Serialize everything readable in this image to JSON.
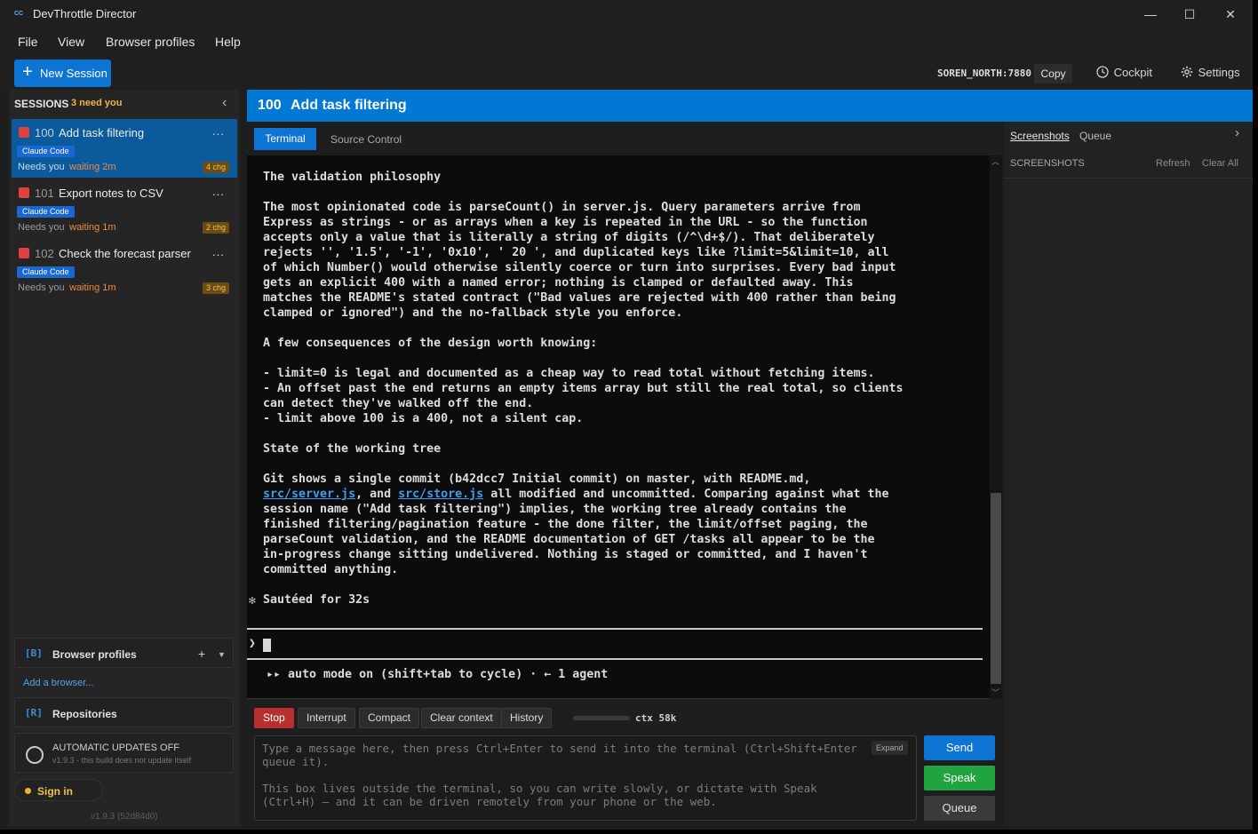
{
  "app": {
    "logo_text": "CC",
    "title": "DevThrottle Director"
  },
  "window": {
    "minimize": "—",
    "maximize": "☐",
    "close": "✕"
  },
  "menu": [
    "File",
    "View",
    "Browser profiles",
    "Help"
  ],
  "toolbar": {
    "new_session_icon": "+",
    "new_session_label": "New Session",
    "host": "SOREN_NORTH:7880",
    "copy_label": "Copy",
    "cockpit_icon": "clock-icon",
    "cockpit_label": "Cockpit",
    "settings_icon": "gear-icon",
    "settings_label": "Settings"
  },
  "sidebar": {
    "heading": "SESSIONS",
    "need_count": "3 need you",
    "collapse_glyph": "‹",
    "sessions": [
      {
        "num": "100",
        "title": "Add task filtering",
        "menu": "...",
        "badge": "Claude Code",
        "needs": "Needs you",
        "waiting": "waiting 2m",
        "changes": "4 chg"
      },
      {
        "num": "101",
        "title": "Export notes to CSV",
        "menu": "...",
        "badge": "Claude Code",
        "needs": "Needs you",
        "waiting": "waiting 1m",
        "changes": "2 chg"
      },
      {
        "num": "102",
        "title": "Check the forecast parser",
        "menu": "...",
        "badge": "Claude Code",
        "needs": "Needs you",
        "waiting": "waiting 1m",
        "changes": "3 chg"
      }
    ],
    "browser_profiles": {
      "tag": "[B]",
      "label": "Browser profiles",
      "plus": "+",
      "chevron": "▼",
      "add_link": "Add a browser..."
    },
    "repositories": {
      "tag": "[R]",
      "label": "Repositories"
    },
    "updates": {
      "title": "AUTOMATIC UPDATES OFF",
      "subtitle": "v1.9.3 - this build does not update itself"
    },
    "signin_label": "Sign in",
    "version": "v1.9.3 (52d84d0)"
  },
  "header": {
    "num": "100",
    "title": "Add task filtering"
  },
  "tabs": {
    "terminal": "Terminal",
    "source_control": "Source Control"
  },
  "terminal": {
    "l01": "The validation philosophy",
    "l02": "The most opinionated code is parseCount() in server.js. Query parameters arrive from",
    "l03": "Express as strings - or as arrays when a key is repeated in the URL - so the function",
    "l04": "accepts only a value that is literally a string of digits (/^\\d+$/). That deliberately",
    "l05": "rejects '', '1.5', '-1', '0x10', ' 20 ', and duplicated keys like ?limit=5&limit=10, all",
    "l06": "of which Number() would otherwise silently coerce or turn into surprises. Every bad input",
    "l07": "gets an explicit 400 with a named error; nothing is clamped or defaulted away. This",
    "l08": "matches the README's stated contract (\"Bad values are rejected with 400 rather than being",
    "l09": "clamped or ignored\") and the no-fallback style you enforce.",
    "l10": "A few consequences of the design worth knowing:",
    "l11": "- limit=0 is legal and documented as a cheap way to read total without fetching items.",
    "l12": "- An offset past the end returns an empty items array but still the real total, so clients",
    "l13": "can detect they've walked off the end.",
    "l14": "- limit above 100 is a 400, not a silent cap.",
    "l15": "State of the working tree",
    "l16": "Git shows a single commit (b42dcc7 Initial commit) on master, with README.md,",
    "l17_link1": "src/server.js",
    "l17_mid": ", and ",
    "l17_link2": "src/store.js",
    "l17_rest": " all modified and uncommitted. Comparing against what the",
    "l18": "session name (\"Add task filtering\") implies, the working tree already contains the",
    "l19": "finished filtering/pagination feature - the done filter, the limit/offset paging, the",
    "l20": "parseCount validation, and the README documentation of GET /tasks all appear to be the",
    "l21": "in-progress change sitting undelivered. Nothing is staged or committed, and I haven't",
    "l22": "committed anything.",
    "l23": "Sautéed for 32s",
    "spinner": "✻",
    "prompt": "❯",
    "automode": "▸▸ auto mode on (shift+tab to cycle) · ← 1 agent"
  },
  "controls": {
    "stop": "Stop",
    "interrupt": "Interrupt",
    "compact": "Compact",
    "clear_context": "Clear context",
    "history": "History",
    "ctx": "ctx 58k"
  },
  "message": {
    "placeholder": "Type a message here, then press Ctrl+Enter to send it into the terminal (Ctrl+Shift+Enter queue it).\n\nThis box lives outside the terminal, so you can write slowly, or dictate with Speak (Ctrl+H) — and it can be driven remotely from your phone or the web.",
    "expand": "Expand",
    "send": "Send",
    "speak": "Speak",
    "queue": "Queue"
  },
  "right": {
    "tab_screenshots": "Screenshots",
    "tab_queue": "Queue",
    "chevron": "›",
    "heading": "SCREENSHOTS",
    "refresh": "Refresh",
    "clear_all": "Clear All"
  },
  "colors": {
    "accent": "#0078d4",
    "stop": "#b72f2f",
    "speak": "#21a33f",
    "needs": "#f0b34a"
  }
}
